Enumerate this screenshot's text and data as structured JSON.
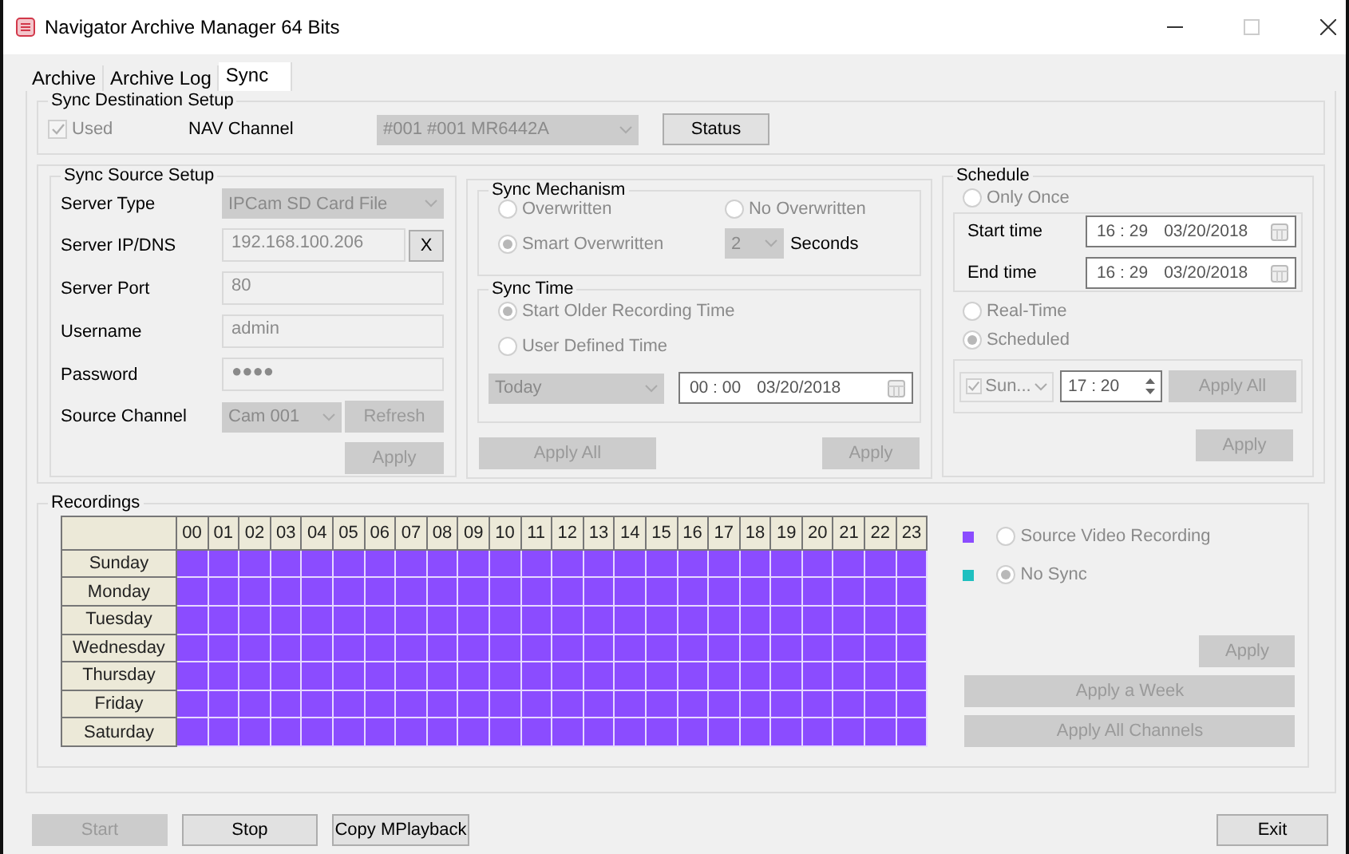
{
  "window": {
    "title": "Navigator Archive Manager 64 Bits"
  },
  "tabs": [
    {
      "label": "Archive",
      "selected": false
    },
    {
      "label": "Archive Log",
      "selected": false
    },
    {
      "label": "Sync",
      "selected": true
    }
  ],
  "destination": {
    "title": "Sync Destination Setup",
    "used": {
      "label": "Used",
      "checked": true
    },
    "channel_label": "NAV Channel",
    "channel_value": "#001  #001 MR6442A",
    "status_button": {
      "label": "Status",
      "disabled": false
    }
  },
  "source": {
    "title": "Sync Source Setup",
    "fields": [
      {
        "label": "Server Type",
        "kind": "select",
        "value": "IPCam SD Card File"
      },
      {
        "label": "Server IP/DNS",
        "kind": "input_button",
        "value": "192.168.100.206",
        "button": {
          "label": "X",
          "disabled": false
        }
      },
      {
        "label": "Server Port",
        "kind": "input",
        "value": "80"
      },
      {
        "label": "Username",
        "kind": "input",
        "value": "admin"
      },
      {
        "label": "Password",
        "kind": "input",
        "value": "●●●●"
      },
      {
        "label": "Source Channel",
        "kind": "select_button",
        "value": "Cam 001",
        "button": {
          "label": "Refresh",
          "disabled": true
        }
      }
    ],
    "apply": {
      "label": "Apply",
      "disabled": true
    }
  },
  "mechanism": {
    "title": "Sync Mechanism",
    "options": [
      {
        "label": "Overwritten",
        "selected": false
      },
      {
        "label": "No Overwritten",
        "selected": false
      },
      {
        "label": "Smart Overwritten",
        "selected": true
      }
    ],
    "seconds_value": "2",
    "seconds_label": "Seconds"
  },
  "sync_time": {
    "title": "Sync Time",
    "options": [
      {
        "label": "Start Older Recording Time",
        "selected": true
      },
      {
        "label": "User Defined Time",
        "selected": false
      }
    ],
    "range_value": "Today",
    "time": "00 : 00",
    "date": "03/20/2018",
    "apply_all": {
      "label": "Apply All",
      "disabled": true
    },
    "apply": {
      "label": "Apply",
      "disabled": true
    }
  },
  "schedule": {
    "title": "Schedule",
    "only_once": {
      "label": "Only Once",
      "selected": false
    },
    "times": [
      {
        "label": "Start time",
        "time": "16 : 29",
        "date": "03/20/2018"
      },
      {
        "label": "End time",
        "time": "16 : 29",
        "date": "03/20/2018"
      }
    ],
    "modes": [
      {
        "label": "Real-Time",
        "selected": false
      },
      {
        "label": "Scheduled",
        "selected": true
      }
    ],
    "day": {
      "checked": true,
      "value": "Sun..."
    },
    "time": "17 : 20",
    "apply_all": {
      "label": "Apply All",
      "disabled": true
    },
    "apply": {
      "label": "Apply",
      "disabled": true
    }
  },
  "recordings": {
    "title": "Recordings",
    "hours": [
      "00",
      "01",
      "02",
      "03",
      "04",
      "05",
      "06",
      "07",
      "08",
      "09",
      "10",
      "11",
      "12",
      "13",
      "14",
      "15",
      "16",
      "17",
      "18",
      "19",
      "20",
      "21",
      "22",
      "23"
    ],
    "days": [
      "Sunday",
      "Monday",
      "Tuesday",
      "Wednesday",
      "Thursday",
      "Friday",
      "Saturday"
    ],
    "legend": [
      {
        "label": "Source Video Recording",
        "color": "#8b4cff",
        "selected": false
      },
      {
        "label": "No Sync",
        "color": "#1fc0c0",
        "selected": true
      }
    ],
    "buttons": [
      {
        "label": "Apply",
        "disabled": true,
        "wide": false
      },
      {
        "label": "Apply a Week",
        "disabled": true,
        "wide": true
      },
      {
        "label": "Apply All Channels",
        "disabled": true,
        "wide": true
      }
    ]
  },
  "footer": {
    "left": [
      {
        "label": "Start",
        "disabled": true
      },
      {
        "label": "Stop",
        "disabled": false
      },
      {
        "label": "Copy MPlayback",
        "disabled": false
      }
    ],
    "right": [
      {
        "label": "Exit",
        "disabled": false
      }
    ]
  }
}
